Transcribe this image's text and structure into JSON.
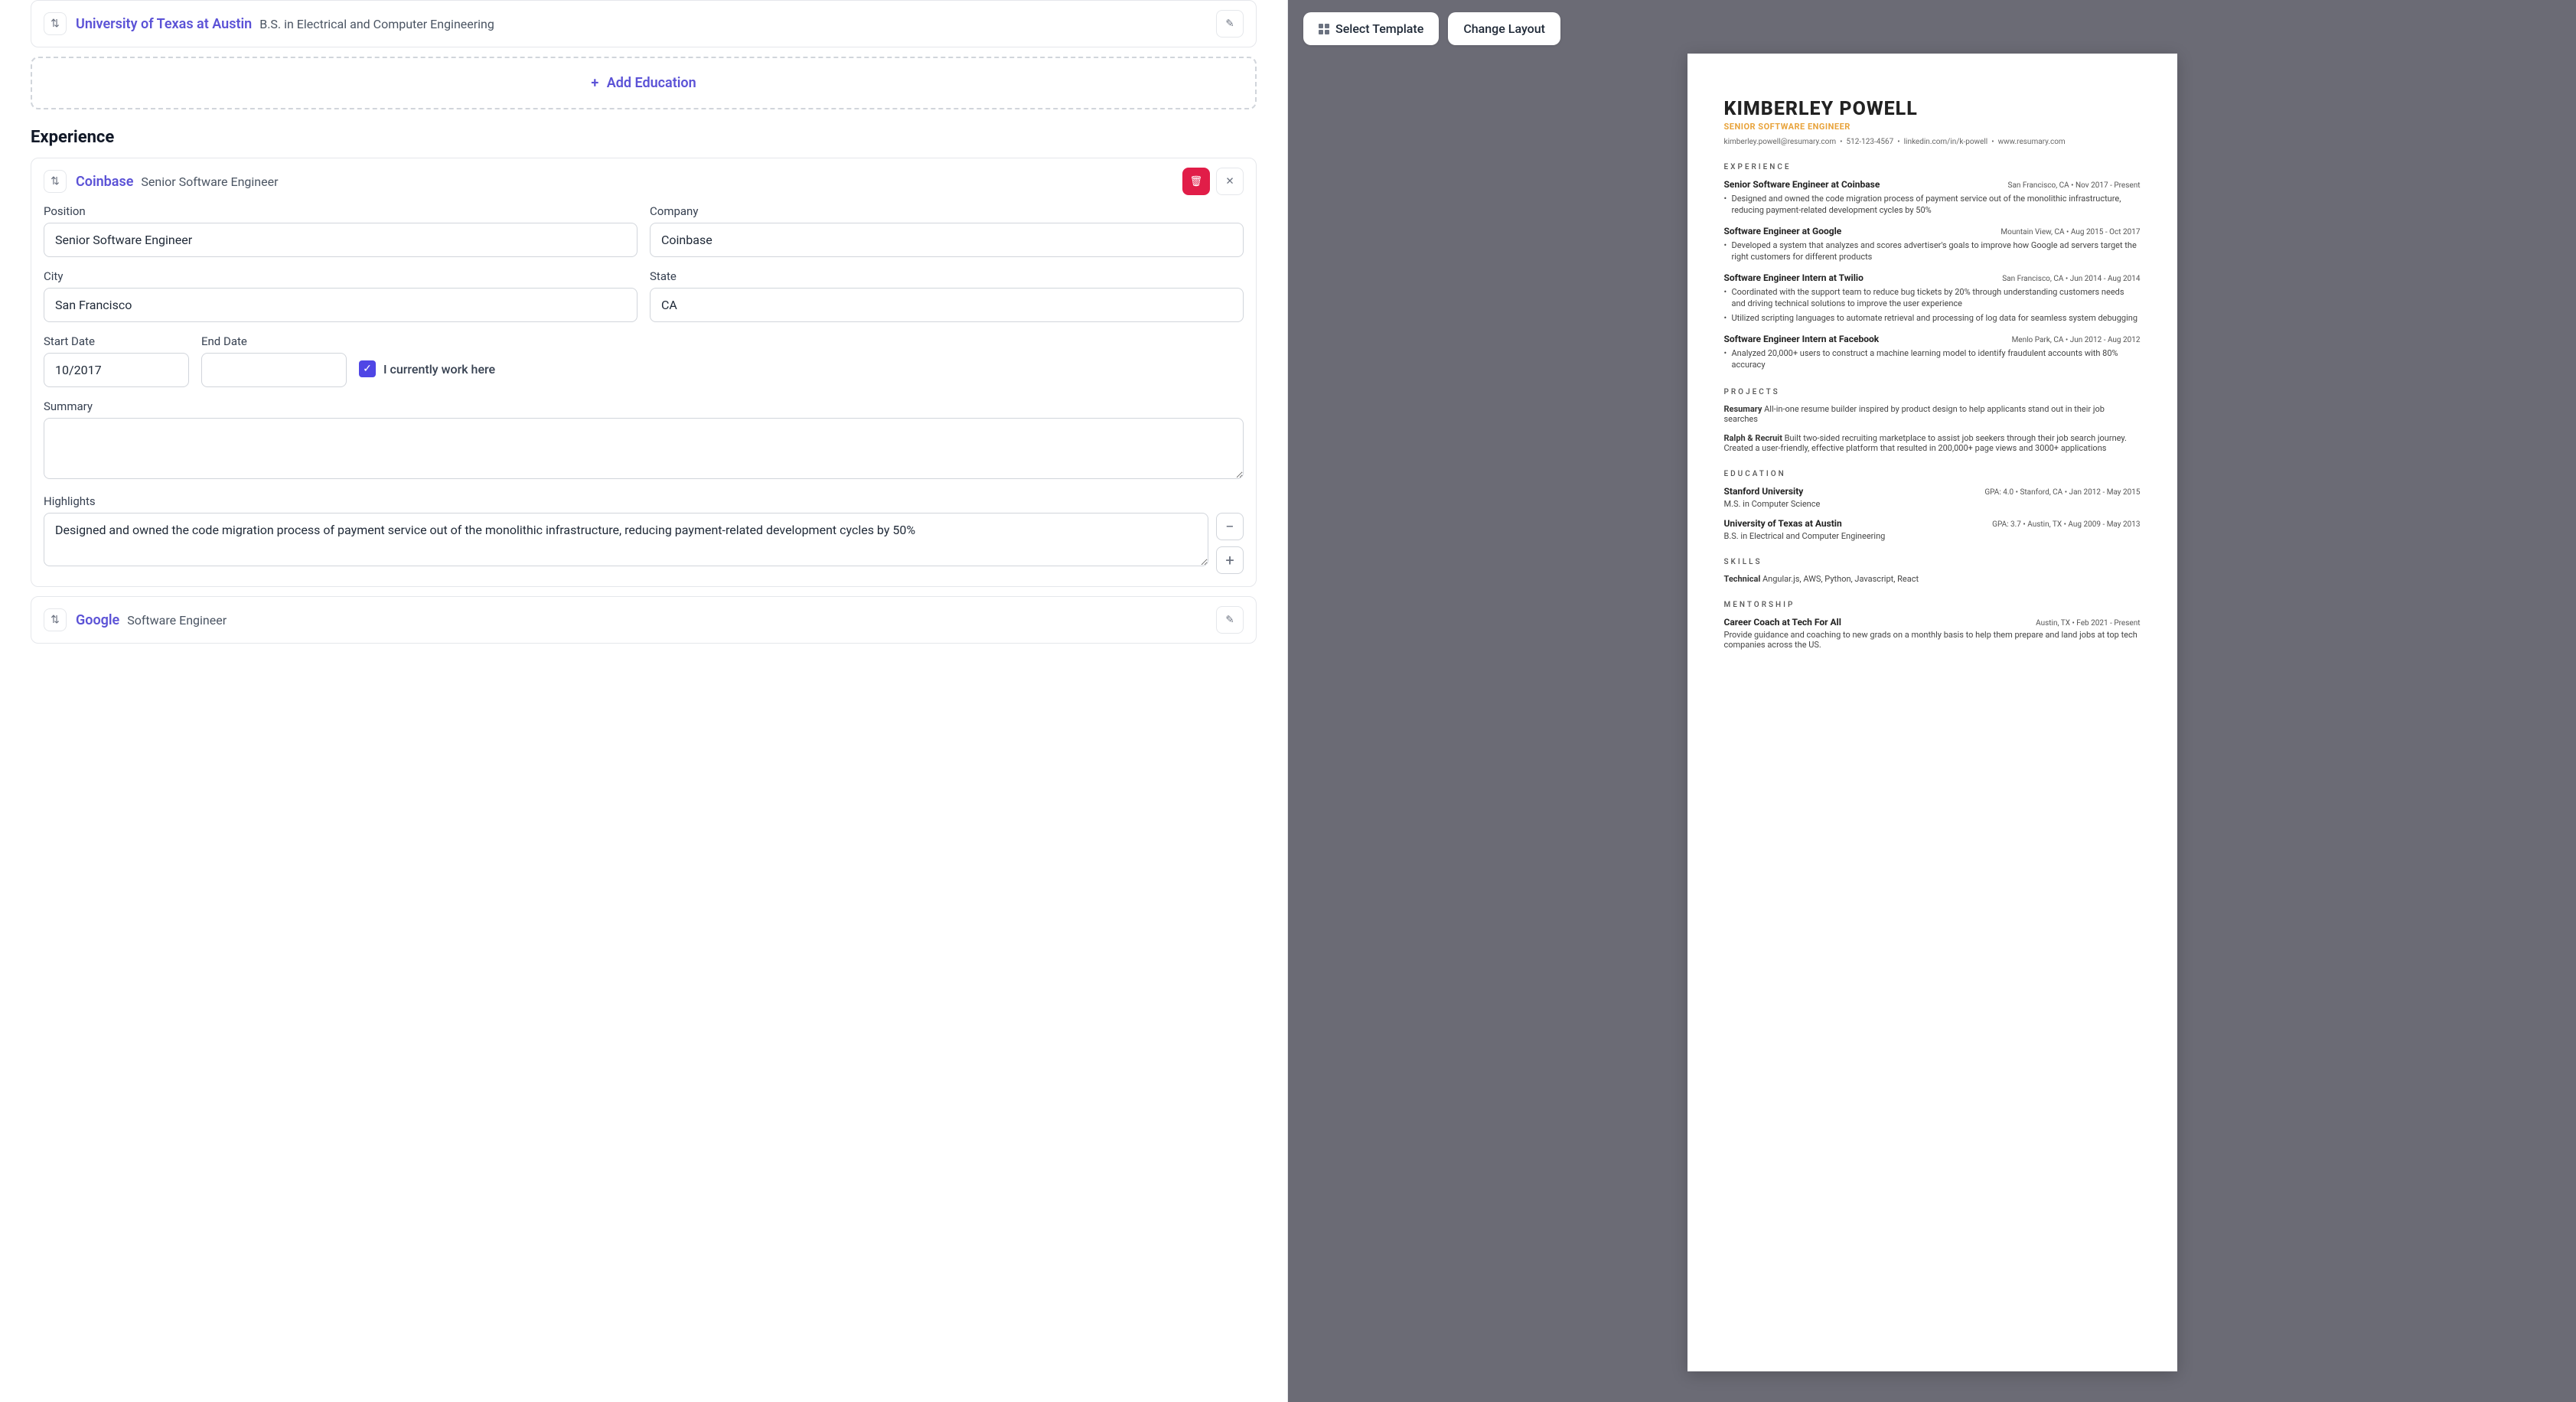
{
  "editor": {
    "education_card": {
      "title": "University of Texas at Austin",
      "subtitle": "B.S. in Electrical and Computer Engineering"
    },
    "add_education_label": "Add Education",
    "experience_heading": "Experience",
    "coinbase_card": {
      "title": "Coinbase",
      "subtitle": "Senior Software Engineer",
      "fields": {
        "position_label": "Position",
        "position_value": "Senior Software Engineer",
        "company_label": "Company",
        "company_value": "Coinbase",
        "city_label": "City",
        "city_value": "San Francisco",
        "state_label": "State",
        "state_value": "CA",
        "start_date_label": "Start Date",
        "start_date_value": "10/2017",
        "end_date_label": "End Date",
        "end_date_value": "",
        "currently_work_label": "I currently work here",
        "summary_label": "Summary",
        "summary_value": "",
        "highlights_label": "Highlights",
        "highlight_value": "Designed and owned the code migration process of payment service out of the monolithic infrastructure, reducing payment-related development cycles by 50%"
      }
    },
    "google_card": {
      "title": "Google",
      "subtitle": "Software Engineer"
    }
  },
  "preview_toolbar": {
    "select_template_label": "Select Template",
    "change_layout_label": "Change Layout"
  },
  "resume": {
    "name": "KIMBERLEY POWELL",
    "jobtitle": "SENIOR SOFTWARE ENGINEER",
    "contact": {
      "email": "kimberley.powell@resumary.com",
      "phone": "512-123-4567",
      "linkedin": "linkedin.com/in/k-powell",
      "website": "www.resumary.com"
    },
    "sections": {
      "experience": "EXPERIENCE",
      "projects": "PROJECTS",
      "education": "EDUCATION",
      "skills": "SKILLS",
      "mentorship": "MENTORSHIP"
    },
    "experience": [
      {
        "title": "Senior Software Engineer at Coinbase",
        "meta": "San Francisco, CA • Nov 2017 - Present",
        "bullets": [
          "Designed and owned the code migration process of payment service out of the monolithic infrastructure, reducing payment-related development cycles by 50%"
        ]
      },
      {
        "title": "Software Engineer at Google",
        "meta": "Mountain View, CA • Aug 2015 - Oct 2017",
        "bullets": [
          "Developed a system that analyzes and scores advertiser's goals to improve how Google ad servers target the right customers for different products"
        ]
      },
      {
        "title": "Software Engineer Intern at Twilio",
        "meta": "San Francisco, CA • Jun 2014 - Aug 2014",
        "bullets": [
          "Coordinated with the support team to reduce bug tickets by 20% through understanding customers needs and driving technical solutions to improve the user experience",
          "Utilized scripting languages to automate retrieval and processing of log data for seamless system debugging"
        ]
      },
      {
        "title": "Software Engineer Intern at Facebook",
        "meta": "Menlo Park, CA • Jun 2012 - Aug 2012",
        "bullets": [
          "Analyzed 20,000+ users to construct a machine learning model to identify fraudulent accounts with 80% accuracy"
        ]
      }
    ],
    "projects": [
      {
        "name": "Resumary",
        "desc": "All-in-one resume builder inspired by product design to help applicants stand out in their job searches"
      },
      {
        "name": "Ralph & Recruit",
        "desc": "Built two-sided recruiting marketplace to assist job seekers through their job search journey. Created a user-friendly, effective platform that resulted in 200,000+ page views and 3000+ applications"
      }
    ],
    "education": [
      {
        "school": "Stanford University",
        "meta": "GPA: 4.0 • Stanford, CA • Jan 2012 - May 2015",
        "degree": "M.S. in Computer Science"
      },
      {
        "school": "University of Texas at Austin",
        "meta": "GPA: 3.7 • Austin, TX • Aug 2009 - May 2013",
        "degree": "B.S. in Electrical and Computer Engineering"
      }
    ],
    "skills": {
      "category": "Technical",
      "list": "Angular.js, AWS, Python, Javascript, React"
    },
    "mentorship": {
      "title": "Career Coach at Tech For All",
      "meta": "Austin, TX • Feb 2021 - Present",
      "desc": "Provide guidance and coaching to new grads on a monthly basis to help them prepare and land jobs at top tech companies across the US."
    }
  }
}
